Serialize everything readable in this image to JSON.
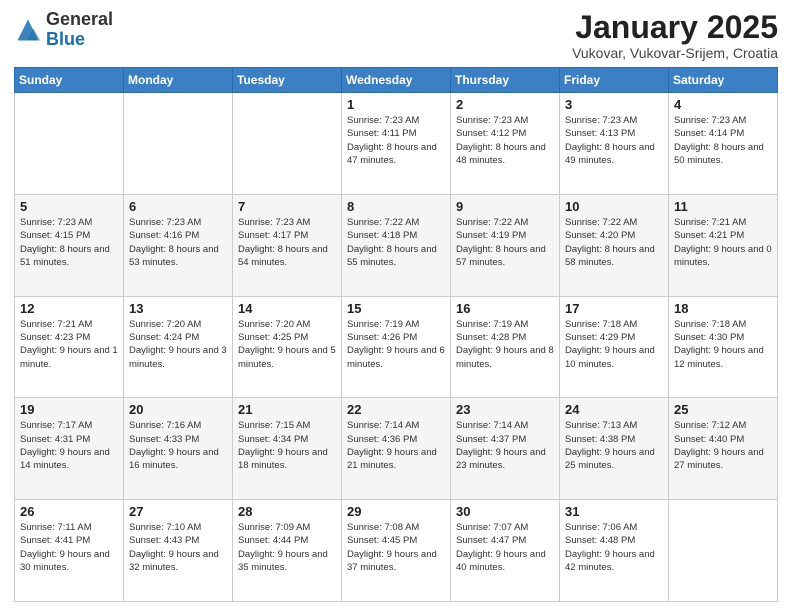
{
  "header": {
    "logo_general": "General",
    "logo_blue": "Blue",
    "month_title": "January 2025",
    "location": "Vukovar, Vukovar-Srijem, Croatia"
  },
  "days_of_week": [
    "Sunday",
    "Monday",
    "Tuesday",
    "Wednesday",
    "Thursday",
    "Friday",
    "Saturday"
  ],
  "weeks": [
    [
      {
        "day": "",
        "info": ""
      },
      {
        "day": "",
        "info": ""
      },
      {
        "day": "",
        "info": ""
      },
      {
        "day": "1",
        "info": "Sunrise: 7:23 AM\nSunset: 4:11 PM\nDaylight: 8 hours and 47 minutes."
      },
      {
        "day": "2",
        "info": "Sunrise: 7:23 AM\nSunset: 4:12 PM\nDaylight: 8 hours and 48 minutes."
      },
      {
        "day": "3",
        "info": "Sunrise: 7:23 AM\nSunset: 4:13 PM\nDaylight: 8 hours and 49 minutes."
      },
      {
        "day": "4",
        "info": "Sunrise: 7:23 AM\nSunset: 4:14 PM\nDaylight: 8 hours and 50 minutes."
      }
    ],
    [
      {
        "day": "5",
        "info": "Sunrise: 7:23 AM\nSunset: 4:15 PM\nDaylight: 8 hours and 51 minutes."
      },
      {
        "day": "6",
        "info": "Sunrise: 7:23 AM\nSunset: 4:16 PM\nDaylight: 8 hours and 53 minutes."
      },
      {
        "day": "7",
        "info": "Sunrise: 7:23 AM\nSunset: 4:17 PM\nDaylight: 8 hours and 54 minutes."
      },
      {
        "day": "8",
        "info": "Sunrise: 7:22 AM\nSunset: 4:18 PM\nDaylight: 8 hours and 55 minutes."
      },
      {
        "day": "9",
        "info": "Sunrise: 7:22 AM\nSunset: 4:19 PM\nDaylight: 8 hours and 57 minutes."
      },
      {
        "day": "10",
        "info": "Sunrise: 7:22 AM\nSunset: 4:20 PM\nDaylight: 8 hours and 58 minutes."
      },
      {
        "day": "11",
        "info": "Sunrise: 7:21 AM\nSunset: 4:21 PM\nDaylight: 9 hours and 0 minutes."
      }
    ],
    [
      {
        "day": "12",
        "info": "Sunrise: 7:21 AM\nSunset: 4:23 PM\nDaylight: 9 hours and 1 minute."
      },
      {
        "day": "13",
        "info": "Sunrise: 7:20 AM\nSunset: 4:24 PM\nDaylight: 9 hours and 3 minutes."
      },
      {
        "day": "14",
        "info": "Sunrise: 7:20 AM\nSunset: 4:25 PM\nDaylight: 9 hours and 5 minutes."
      },
      {
        "day": "15",
        "info": "Sunrise: 7:19 AM\nSunset: 4:26 PM\nDaylight: 9 hours and 6 minutes."
      },
      {
        "day": "16",
        "info": "Sunrise: 7:19 AM\nSunset: 4:28 PM\nDaylight: 9 hours and 8 minutes."
      },
      {
        "day": "17",
        "info": "Sunrise: 7:18 AM\nSunset: 4:29 PM\nDaylight: 9 hours and 10 minutes."
      },
      {
        "day": "18",
        "info": "Sunrise: 7:18 AM\nSunset: 4:30 PM\nDaylight: 9 hours and 12 minutes."
      }
    ],
    [
      {
        "day": "19",
        "info": "Sunrise: 7:17 AM\nSunset: 4:31 PM\nDaylight: 9 hours and 14 minutes."
      },
      {
        "day": "20",
        "info": "Sunrise: 7:16 AM\nSunset: 4:33 PM\nDaylight: 9 hours and 16 minutes."
      },
      {
        "day": "21",
        "info": "Sunrise: 7:15 AM\nSunset: 4:34 PM\nDaylight: 9 hours and 18 minutes."
      },
      {
        "day": "22",
        "info": "Sunrise: 7:14 AM\nSunset: 4:36 PM\nDaylight: 9 hours and 21 minutes."
      },
      {
        "day": "23",
        "info": "Sunrise: 7:14 AM\nSunset: 4:37 PM\nDaylight: 9 hours and 23 minutes."
      },
      {
        "day": "24",
        "info": "Sunrise: 7:13 AM\nSunset: 4:38 PM\nDaylight: 9 hours and 25 minutes."
      },
      {
        "day": "25",
        "info": "Sunrise: 7:12 AM\nSunset: 4:40 PM\nDaylight: 9 hours and 27 minutes."
      }
    ],
    [
      {
        "day": "26",
        "info": "Sunrise: 7:11 AM\nSunset: 4:41 PM\nDaylight: 9 hours and 30 minutes."
      },
      {
        "day": "27",
        "info": "Sunrise: 7:10 AM\nSunset: 4:43 PM\nDaylight: 9 hours and 32 minutes."
      },
      {
        "day": "28",
        "info": "Sunrise: 7:09 AM\nSunset: 4:44 PM\nDaylight: 9 hours and 35 minutes."
      },
      {
        "day": "29",
        "info": "Sunrise: 7:08 AM\nSunset: 4:45 PM\nDaylight: 9 hours and 37 minutes."
      },
      {
        "day": "30",
        "info": "Sunrise: 7:07 AM\nSunset: 4:47 PM\nDaylight: 9 hours and 40 minutes."
      },
      {
        "day": "31",
        "info": "Sunrise: 7:06 AM\nSunset: 4:48 PM\nDaylight: 9 hours and 42 minutes."
      },
      {
        "day": "",
        "info": ""
      }
    ]
  ]
}
